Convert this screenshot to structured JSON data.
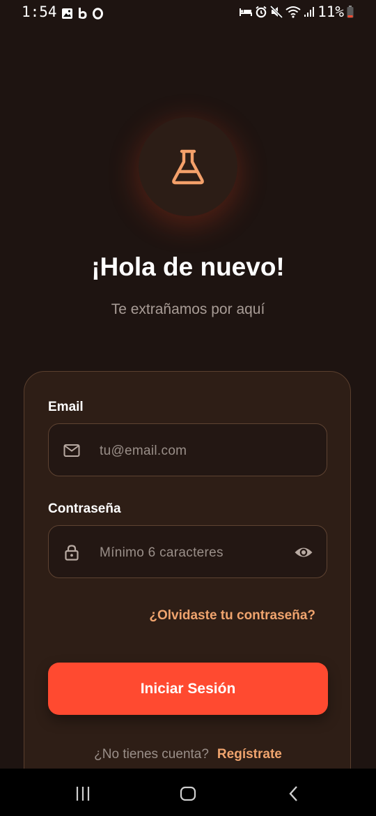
{
  "status_bar": {
    "time": "1:54",
    "battery": "11%",
    "left_icons": [
      "gallery-icon",
      "b-app-icon",
      "o-app-icon"
    ],
    "right_icons": [
      "bed-icon",
      "alarm-icon",
      "mute-icon",
      "wifi-icon",
      "signal-icon",
      "battery-icon"
    ]
  },
  "logo": {
    "icon": "flask-icon",
    "accent": "#f4a06a"
  },
  "header": {
    "title": "¡Hola de nuevo!",
    "subtitle": "Te extrañamos por aquí"
  },
  "form": {
    "email": {
      "label": "Email",
      "placeholder": "tu@email.com",
      "icon": "mail-icon"
    },
    "password": {
      "label": "Contraseña",
      "placeholder": "Mínimo 6 caracteres",
      "icon": "lock-icon",
      "toggle_icon": "eye-icon"
    },
    "forgot_link": "¿Olvidaste tu contraseña?",
    "submit_label": "Iniciar Sesión"
  },
  "signup": {
    "question": "¿No tienes cuenta?",
    "link": "Regístrate"
  },
  "colors": {
    "background": "#1e1411",
    "card": "#2e1e16",
    "primary_button": "#ff4a30",
    "link": "#f0a46e"
  },
  "nav_bar": {
    "buttons": [
      "recent-apps-icon",
      "home-icon",
      "back-icon"
    ]
  }
}
